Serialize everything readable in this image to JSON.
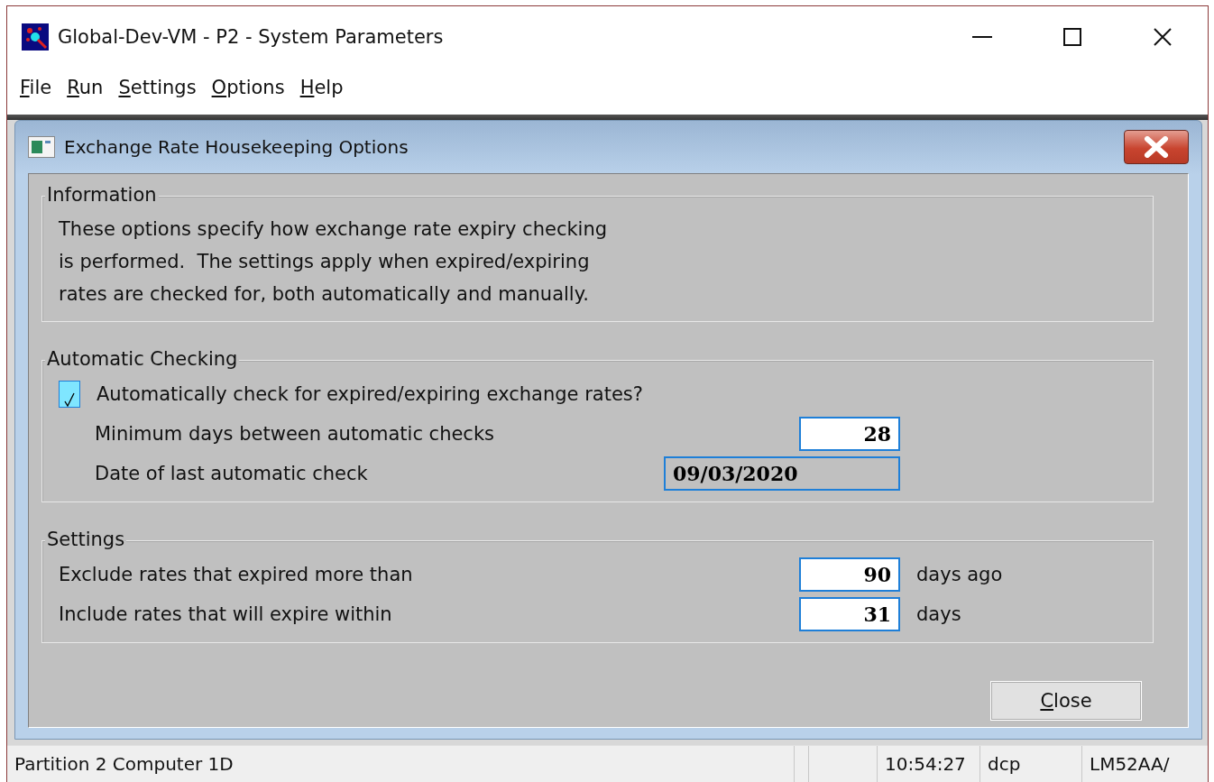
{
  "window": {
    "title": "Global-Dev-VM - P2 - System Parameters"
  },
  "menu": [
    "File",
    "Run",
    "Settings",
    "Options",
    "Help"
  ],
  "dialog": {
    "title": "Exchange Rate Housekeeping Options",
    "groups": [
      {
        "title": "Information",
        "kind": "text",
        "text": "These options specify how exchange rate expiry checking\nis performed.  The settings apply when expired/expiring\nrates are checked for, both automatically and manually."
      },
      {
        "title": "Automatic Checking",
        "kind": "fields",
        "rows": [
          {
            "kind": "checkbox",
            "label": "Automatically check for expired/expiring exchange rates?",
            "checked": true
          },
          {
            "kind": "field",
            "label": "Minimum days between automatic checks",
            "value": "28",
            "editable": true,
            "indented": true
          },
          {
            "kind": "field",
            "label": "Date of last automatic check",
            "value": "09/03/2020",
            "editable": false,
            "indented": true
          }
        ]
      },
      {
        "title": "Settings",
        "kind": "fields",
        "rows": [
          {
            "kind": "field",
            "label": "Exclude rates that expired more than",
            "value": "90",
            "editable": true,
            "indented": false,
            "suffix": "days ago"
          },
          {
            "kind": "field",
            "label": "Include rates that will expire within",
            "value": "31",
            "editable": true,
            "indented": false,
            "suffix": "days"
          }
        ]
      }
    ],
    "buttons": [
      "Close"
    ]
  },
  "status_bar": [
    "Partition 2 Computer 1D",
    "10:54:27",
    "dcp",
    "LM52AA/"
  ]
}
